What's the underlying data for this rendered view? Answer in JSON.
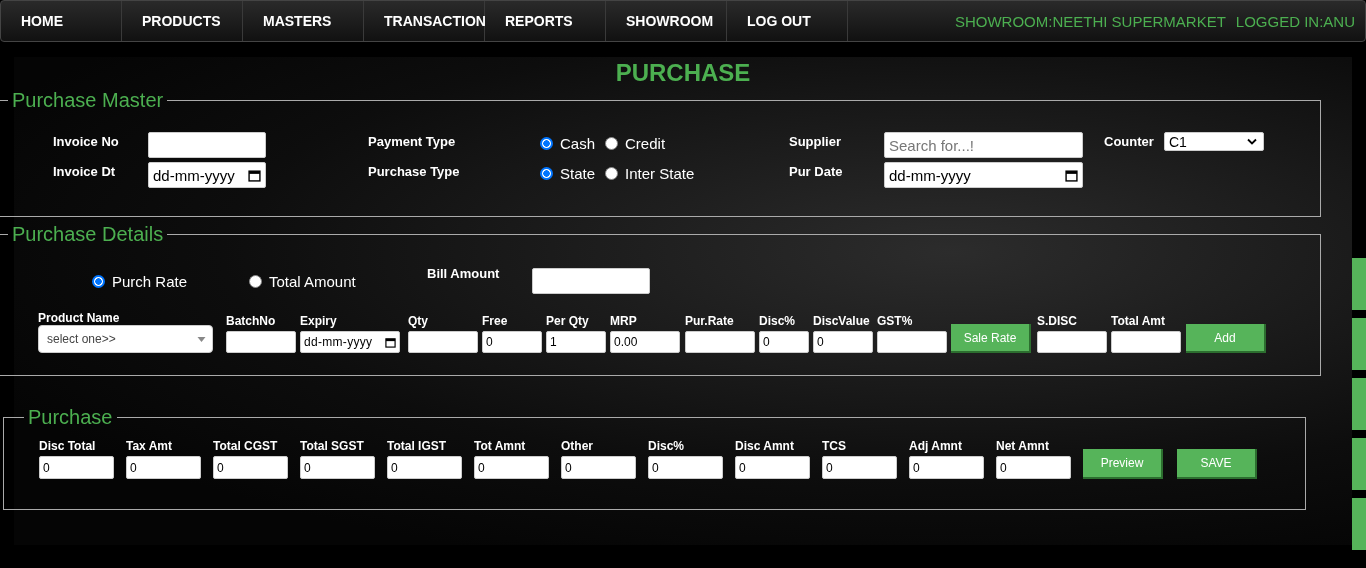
{
  "nav": {
    "items": [
      {
        "label": "HOME"
      },
      {
        "label": "PRODUCTS"
      },
      {
        "label": "MASTERS"
      },
      {
        "label": "TRANSACTION"
      },
      {
        "label": "REPORTS"
      },
      {
        "label": "SHOWROOM"
      },
      {
        "label": "LOG OUT"
      }
    ],
    "showroom": "SHOWROOM:NEETHI SUPERMARKET",
    "logged_in": "LOGGED IN:ANU"
  },
  "page_title": "PURCHASE",
  "purchase_master": {
    "legend": "Purchase Master",
    "invoice_no": {
      "label": "Invoice No"
    },
    "invoice_dt": {
      "label": "Invoice Dt",
      "placeholder": "dd-mm-yyyy"
    },
    "payment_type": {
      "label": "Payment Type",
      "options": [
        {
          "label": "Cash",
          "selected": true
        },
        {
          "label": "Credit",
          "selected": false
        }
      ]
    },
    "purchase_type": {
      "label": "Purchase Type",
      "options": [
        {
          "label": "State",
          "selected": true
        },
        {
          "label": "Inter State",
          "selected": false
        }
      ]
    },
    "supplier": {
      "label": "Supplier",
      "placeholder": "Search for...!"
    },
    "pur_date": {
      "label": "Pur Date",
      "placeholder": "dd-mm-yyyy"
    },
    "counter": {
      "label": "Counter",
      "value": "C1"
    }
  },
  "purchase_details": {
    "legend": "Purchase Details",
    "rate_mode": [
      {
        "label": "Purch Rate",
        "selected": true
      },
      {
        "label": "Total Amount",
        "selected": false
      }
    ],
    "bill_amount": {
      "label": "Bill Amount"
    },
    "fields": [
      {
        "kind": "select",
        "label": "Product Name",
        "placeholder": "select one>>"
      },
      {
        "kind": "text",
        "label": "BatchNo"
      },
      {
        "kind": "date",
        "label": "Expiry",
        "placeholder": "dd-mm-yyyy"
      },
      {
        "kind": "text",
        "label": "Qty"
      },
      {
        "kind": "text",
        "label": "Free",
        "value": "0"
      },
      {
        "kind": "text",
        "label": "Per Qty",
        "value": "1"
      },
      {
        "kind": "text",
        "label": "MRP",
        "value": "0.00"
      },
      {
        "kind": "text",
        "label": "Pur.Rate"
      },
      {
        "kind": "text",
        "label": "Disc%",
        "value": "0"
      },
      {
        "kind": "text",
        "label": "DiscValue",
        "value": "0"
      },
      {
        "kind": "text",
        "label": "GST%"
      },
      {
        "kind": "button",
        "label": "Sale Rate"
      },
      {
        "kind": "text",
        "label": "S.DISC"
      },
      {
        "kind": "text",
        "label": "Total Amt"
      },
      {
        "kind": "button",
        "label": "Add"
      }
    ]
  },
  "purchase": {
    "legend": "Purchase",
    "fields": [
      {
        "label": "Disc Total",
        "value": "0"
      },
      {
        "label": "Tax Amt",
        "value": "0"
      },
      {
        "label": "Total CGST",
        "value": "0"
      },
      {
        "label": "Total SGST",
        "value": "0"
      },
      {
        "label": "Total IGST",
        "value": "0"
      },
      {
        "label": "Tot Amnt",
        "value": "0"
      },
      {
        "label": "Other",
        "value": "0"
      },
      {
        "label": "Disc%",
        "value": "0"
      },
      {
        "label": "Disc Amnt",
        "value": "0"
      },
      {
        "label": "TCS",
        "value": "0"
      },
      {
        "label": "Adj Amnt",
        "value": "0"
      },
      {
        "label": "Net Amnt",
        "value": "0"
      }
    ],
    "buttons": [
      {
        "label": "Preview"
      },
      {
        "label": "SAVE"
      }
    ]
  }
}
